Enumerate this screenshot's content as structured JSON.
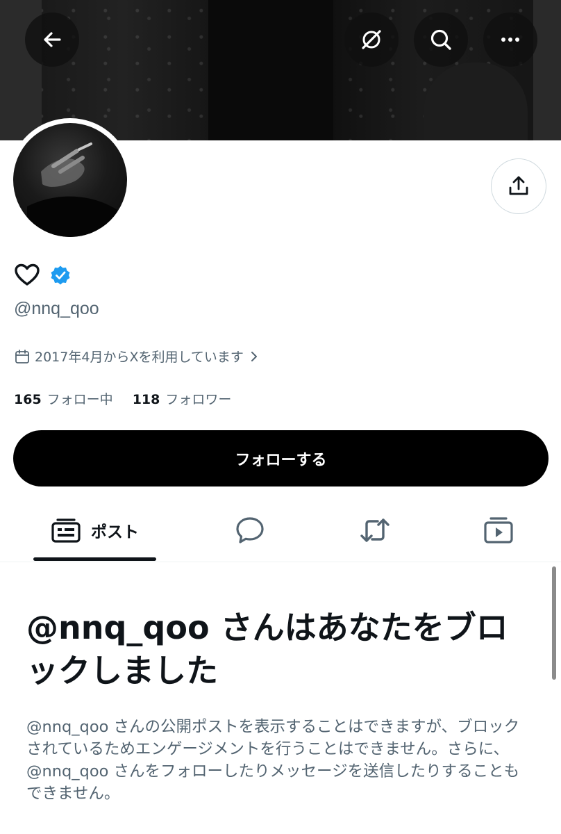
{
  "header": {
    "back_icon": "arrow-left-icon",
    "grok_icon": "grok-icon",
    "search_icon": "search-icon",
    "more_icon": "more-icon"
  },
  "profile": {
    "display_name_icon": "heart-outline-icon",
    "verified_icon": "verified-badge-icon",
    "handle": "@nnq_qoo",
    "joined": "2017年4月からXを利用しています",
    "following_count": "165",
    "following_label": "フォロー中",
    "followers_count": "118",
    "followers_label": "フォロワー"
  },
  "actions": {
    "share_icon": "share-icon",
    "follow_label": "フォローする"
  },
  "tabs": [
    {
      "label": "ポスト",
      "icon": "posts-icon",
      "active": true
    },
    {
      "label": "",
      "icon": "replies-icon",
      "active": false
    },
    {
      "label": "",
      "icon": "repost-icon",
      "active": false
    },
    {
      "label": "",
      "icon": "media-icon",
      "active": false
    }
  ],
  "blocked": {
    "title": "@nnq_qoo さんはあなたをブロックしました",
    "body": "@nnq_qoo さんの公開ポストを表示することはできますが、ブロックされているためエンゲージメントを行うことはできません。さらに、@nnq_qoo さんをフォローしたりメッセージを送信したりすることもできません。"
  },
  "colors": {
    "accent": "#1d9bf0",
    "text_primary": "#0f1419",
    "text_secondary": "#536471",
    "follow_button": "#000000"
  }
}
